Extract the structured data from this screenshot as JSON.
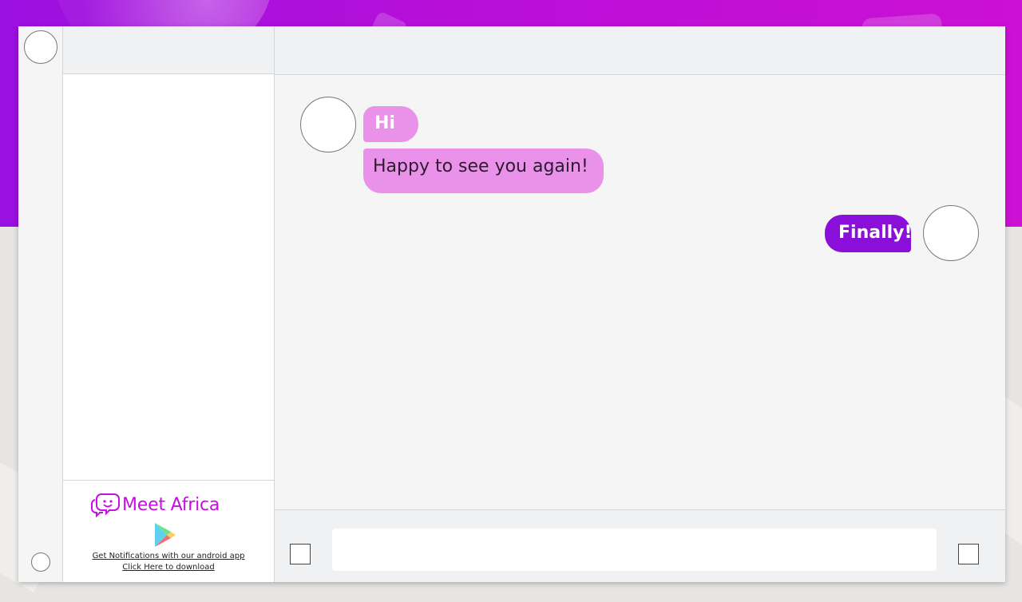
{
  "brand": {
    "name": "Meet Africa",
    "accent_color": "#c410e0"
  },
  "promo": {
    "store_icon": "google-play-icon",
    "line1": "Get Notifications with our android app",
    "line2": "Click Here to download"
  },
  "messages": [
    {
      "direction": "incoming",
      "text": "Hi",
      "color": "#ea92ea"
    },
    {
      "direction": "incoming",
      "text": "Happy to see you again!",
      "color": "#ea92ea"
    },
    {
      "direction": "outgoing",
      "text": "Finally!",
      "color": "#8a0fd8"
    }
  ],
  "composer": {
    "value": "",
    "placeholder": ""
  },
  "colors": {
    "background_gradient_start": "#9a10e0",
    "background_gradient_end": "#cc10d4",
    "incoming_bubble": "#ea92ea",
    "outgoing_bubble": "#8a0fd8"
  }
}
